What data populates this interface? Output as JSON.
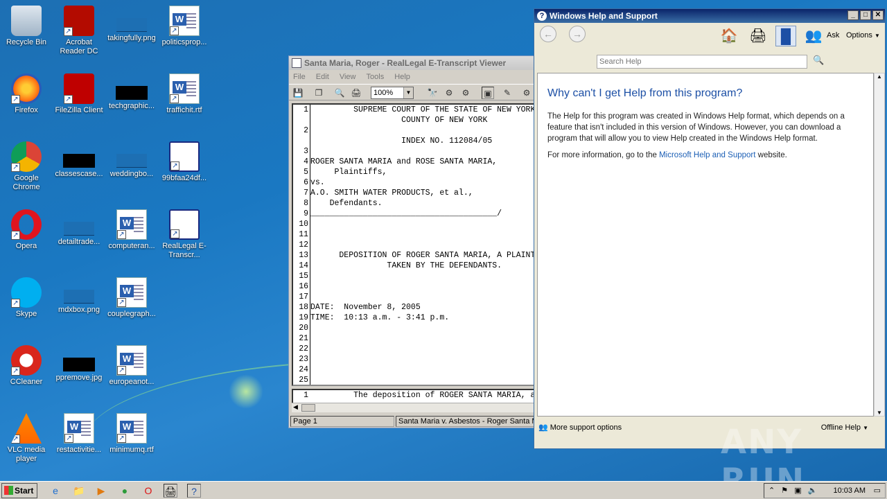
{
  "desktop": {
    "icons": [
      {
        "label": "Recycle Bin"
      },
      {
        "label": "Acrobat Reader DC"
      },
      {
        "label": "takingfully.png"
      },
      {
        "label": "politicsprop..."
      },
      {
        "label": "Firefox"
      },
      {
        "label": "FileZilla Client"
      },
      {
        "label": "techgraphic..."
      },
      {
        "label": "traffichit.rtf"
      },
      {
        "label": "Google Chrome"
      },
      {
        "label": "classescase..."
      },
      {
        "label": "weddingbo..."
      },
      {
        "label": "99bfaa24df..."
      },
      {
        "label": "Opera"
      },
      {
        "label": "detailtrade..."
      },
      {
        "label": "computeran..."
      },
      {
        "label": "RealLegal E-Transcr..."
      },
      {
        "label": "Skype"
      },
      {
        "label": "mdxbox.png"
      },
      {
        "label": "couplegraph..."
      },
      {
        "label": "CCleaner"
      },
      {
        "label": "ppremove.jpg"
      },
      {
        "label": "europeanot..."
      },
      {
        "label": "VLC media player"
      },
      {
        "label": "restactivitie..."
      },
      {
        "label": "minimumq.rtf"
      }
    ]
  },
  "viewer": {
    "title": "Santa Maria, Roger - RealLegal E-Transcript Viewer",
    "menu": [
      "File",
      "Edit",
      "View",
      "Tools",
      "Help"
    ],
    "zoom": "100%",
    "lines": [
      {
        "n": "1",
        "t": "         SUPREME COURT OF THE STATE OF NEW YORK"
      },
      {
        "n": "",
        "t": "                   COUNTY OF NEW YORK"
      },
      {
        "n": "2",
        "t": ""
      },
      {
        "n": "",
        "t": "                   INDEX NO. 112084/05"
      },
      {
        "n": "3",
        "t": ""
      },
      {
        "n": "4",
        "t": "ROGER SANTA MARIA and ROSE SANTA MARIA,"
      },
      {
        "n": "5",
        "t": "     Plaintiffs,"
      },
      {
        "n": "6",
        "t": "vs."
      },
      {
        "n": "7",
        "t": "A.O. SMITH WATER PRODUCTS, et al.,"
      },
      {
        "n": "8",
        "t": "    Defendants."
      },
      {
        "n": "9",
        "t": "_______________________________________/"
      },
      {
        "n": "10",
        "t": ""
      },
      {
        "n": "11",
        "t": ""
      },
      {
        "n": "12",
        "t": ""
      },
      {
        "n": "13",
        "t": "      DEPOSITION OF ROGER SANTA MARIA, A PLAINT"
      },
      {
        "n": "14",
        "t": "                TAKEN BY THE DEFENDANTS."
      },
      {
        "n": "15",
        "t": ""
      },
      {
        "n": "16",
        "t": ""
      },
      {
        "n": "17",
        "t": ""
      },
      {
        "n": "18",
        "t": "DATE:  November 8, 2005"
      },
      {
        "n": "19",
        "t": "TIME:  10:13 a.m. - 3:41 p.m."
      },
      {
        "n": "20",
        "t": ""
      },
      {
        "n": "21",
        "t": ""
      },
      {
        "n": "22",
        "t": ""
      },
      {
        "n": "23",
        "t": ""
      },
      {
        "n": "24",
        "t": ""
      },
      {
        "n": "25",
        "t": ""
      }
    ],
    "second_pane": {
      "n": "1",
      "t": "         The deposition of ROGER SANTA MARIA, a"
    },
    "status_page": "Page 1",
    "status_case": "Santa Maria v. Asbestos  - Roger Santa M"
  },
  "help": {
    "title": "Windows Help and Support",
    "ask_label": "Ask",
    "options_label": "Options",
    "search_placeholder": "Search Help",
    "heading": "Why can't I get Help from this program?",
    "para1": "The Help for this program was created in Windows Help format, which depends on a feature that isn't included in this version of Windows. However, you can download a program that will allow you to view Help created in the Windows Help format.",
    "para2_prefix": "For more information, go to the ",
    "para2_link": "Microsoft Help and Support",
    "para2_suffix": " website.",
    "more_support": "More support options",
    "offline_help": "Offline Help"
  },
  "taskbar": {
    "start_label": "Start",
    "clock": "10:03 AM"
  },
  "watermark": "ANY RUN"
}
